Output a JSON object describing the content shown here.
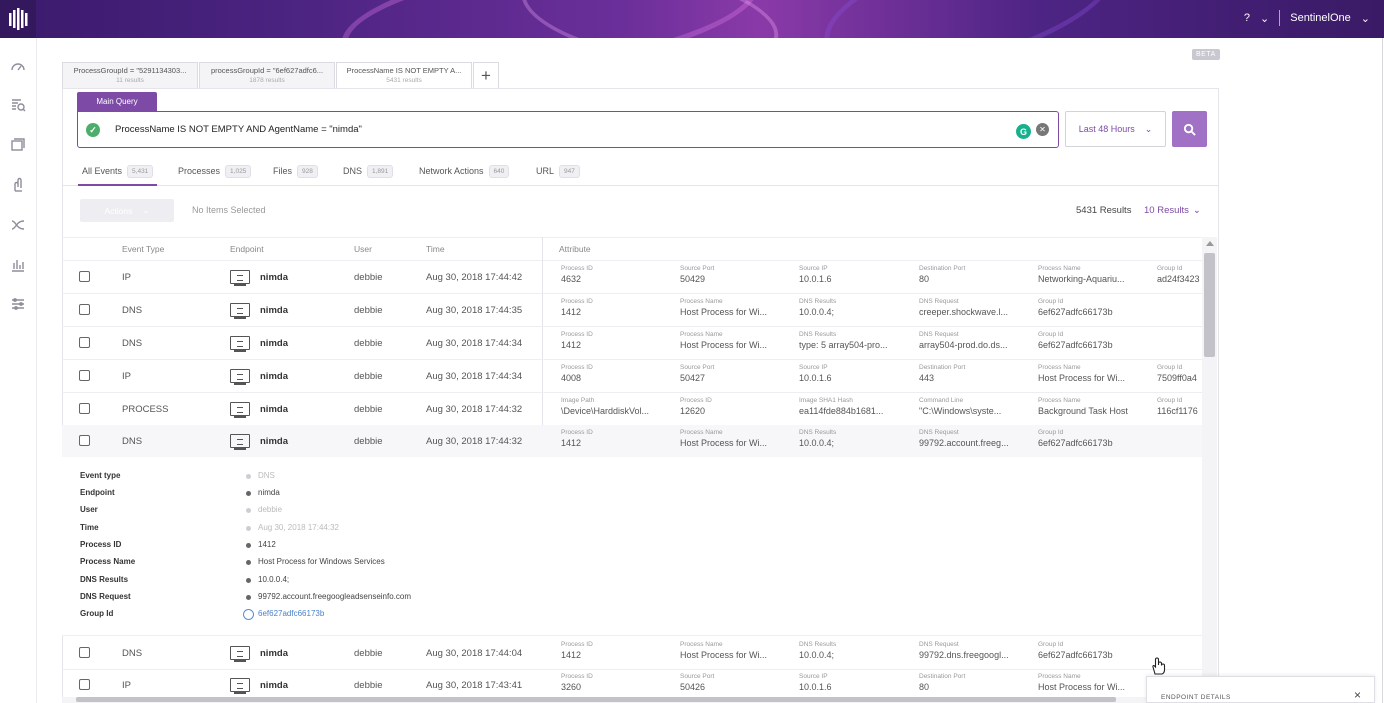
{
  "header": {
    "help_label": "?",
    "account_label": "SentinelOne"
  },
  "beta_label": "BETA",
  "query_tabs": [
    {
      "title": "ProcessGroupId = \"5291134303...",
      "sub": "11 results"
    },
    {
      "title": "processGroupId = \"6ef627adfc6...",
      "sub": "1878 results"
    },
    {
      "title": "ProcessName IS NOT EMPTY A...",
      "sub": "5431 results"
    }
  ],
  "query": {
    "label": "Main Query",
    "text": "ProcessName IS NOT EMPTY AND AgentName = \"nimda\"",
    "time_range": "Last 48 Hours"
  },
  "filter_tabs": [
    {
      "label": "All Events",
      "count": "5,431"
    },
    {
      "label": "Processes",
      "count": "1,025"
    },
    {
      "label": "Files",
      "count": "928"
    },
    {
      "label": "DNS",
      "count": "1,891"
    },
    {
      "label": "Network Actions",
      "count": "640"
    },
    {
      "label": "URL",
      "count": "947"
    }
  ],
  "toolbar": {
    "actions_label": "Actions",
    "selection_status": "No Items Selected",
    "results_count": "5431 Results",
    "results_per_page": "10 Results"
  },
  "columns": [
    "Event Type",
    "Endpoint",
    "User",
    "Time",
    "Attribute"
  ],
  "rows": [
    {
      "type": "IP",
      "endpoint": "nimda",
      "user": "debbie",
      "time": "Aug 30, 2018 17:44:42",
      "attrs": [
        [
          "Process ID",
          "4632"
        ],
        [
          "Source Port",
          "50429"
        ],
        [
          "Source IP",
          "10.0.1.6"
        ],
        [
          "Destination Port",
          "80"
        ],
        [
          "Process Name",
          "Networking-Aquariu..."
        ],
        [
          "Group Id",
          "ad24f3423"
        ]
      ]
    },
    {
      "type": "DNS",
      "endpoint": "nimda",
      "user": "debbie",
      "time": "Aug 30, 2018 17:44:35",
      "attrs": [
        [
          "Process ID",
          "1412"
        ],
        [
          "Process Name",
          "Host Process for Wi..."
        ],
        [
          "DNS Results",
          "10.0.0.4;"
        ],
        [
          "DNS Request",
          "creeper.shockwave.l..."
        ],
        [
          "Group Id",
          "6ef627adfc66173b"
        ]
      ]
    },
    {
      "type": "DNS",
      "endpoint": "nimda",
      "user": "debbie",
      "time": "Aug 30, 2018 17:44:34",
      "attrs": [
        [
          "Process ID",
          "1412"
        ],
        [
          "Process Name",
          "Host Process for Wi..."
        ],
        [
          "DNS Results",
          "type: 5 array504-pro..."
        ],
        [
          "DNS Request",
          "array504-prod.do.ds..."
        ],
        [
          "Group Id",
          "6ef627adfc66173b"
        ]
      ]
    },
    {
      "type": "IP",
      "endpoint": "nimda",
      "user": "debbie",
      "time": "Aug 30, 2018 17:44:34",
      "attrs": [
        [
          "Process ID",
          "4008"
        ],
        [
          "Source Port",
          "50427"
        ],
        [
          "Source IP",
          "10.0.1.6"
        ],
        [
          "Destination Port",
          "443"
        ],
        [
          "Process Name",
          "Host Process for Wi..."
        ],
        [
          "Group Id",
          "7509ff0a4"
        ]
      ]
    },
    {
      "type": "PROCESS",
      "endpoint": "nimda",
      "user": "debbie",
      "time": "Aug 30, 2018 17:44:32",
      "attrs": [
        [
          "Image Path",
          "\\Device\\HarddiskVol..."
        ],
        [
          "Process ID",
          "12620"
        ],
        [
          "Image SHA1 Hash",
          "ea114fde884b1681..."
        ],
        [
          "Command Line",
          "\"C:\\Windows\\syste..."
        ],
        [
          "Process Name",
          "Background Task Host"
        ],
        [
          "Group Id",
          "116cf1176"
        ]
      ]
    },
    {
      "type": "DNS",
      "endpoint": "nimda",
      "user": "debbie",
      "time": "Aug 30, 2018 17:44:32",
      "attrs": [
        [
          "Process ID",
          "1412"
        ],
        [
          "Process Name",
          "Host Process for Wi..."
        ],
        [
          "DNS Results",
          "10.0.0.4;"
        ],
        [
          "DNS Request",
          "99792.account.freeg..."
        ],
        [
          "Group Id",
          "6ef627adfc66173b"
        ]
      ]
    },
    {
      "type": "DNS",
      "endpoint": "nimda",
      "user": "debbie",
      "time": "Aug 30, 2018 17:44:04",
      "attrs": [
        [
          "Process ID",
          "1412"
        ],
        [
          "Process Name",
          "Host Process for Wi..."
        ],
        [
          "DNS Results",
          "10.0.0.4;"
        ],
        [
          "DNS Request",
          "99792.dns.freegoogl..."
        ],
        [
          "Group Id",
          "6ef627adfc66173b"
        ]
      ]
    },
    {
      "type": "IP",
      "endpoint": "nimda",
      "user": "debbie",
      "time": "Aug 30, 2018 17:43:41",
      "attrs": [
        [
          "Process ID",
          "3260"
        ],
        [
          "Source Port",
          "50426"
        ],
        [
          "Source IP",
          "10.0.1.6"
        ],
        [
          "Destination Port",
          "80"
        ],
        [
          "Process Name",
          "Host Process for Wi..."
        ]
      ]
    }
  ],
  "details": [
    {
      "label": "Event type",
      "value": "DNS",
      "style": "light"
    },
    {
      "label": "Endpoint",
      "value": "nimda",
      "style": "normal"
    },
    {
      "label": "User",
      "value": "debbie",
      "style": "light"
    },
    {
      "label": "Time",
      "value": "Aug 30, 2018 17:44:32",
      "style": "light"
    },
    {
      "label": "Process ID",
      "value": "1412",
      "style": "normal"
    },
    {
      "label": "Process Name",
      "value": "Host Process for Windows Services",
      "style": "normal"
    },
    {
      "label": "DNS Results",
      "value": "10.0.0.4;",
      "style": "normal"
    },
    {
      "label": "DNS Request",
      "value": "99792.account.freegoogleadsenseinfo.com",
      "style": "normal"
    },
    {
      "label": "Group Id",
      "value": "6ef627adfc66173b",
      "style": "link"
    }
  ],
  "endpoint_panel": {
    "title": "ENDPOINT DETAILS",
    "close": "×"
  },
  "colors": {
    "accent": "#7d4aa6",
    "success": "#4cae6a",
    "link": "#4a82c8"
  }
}
